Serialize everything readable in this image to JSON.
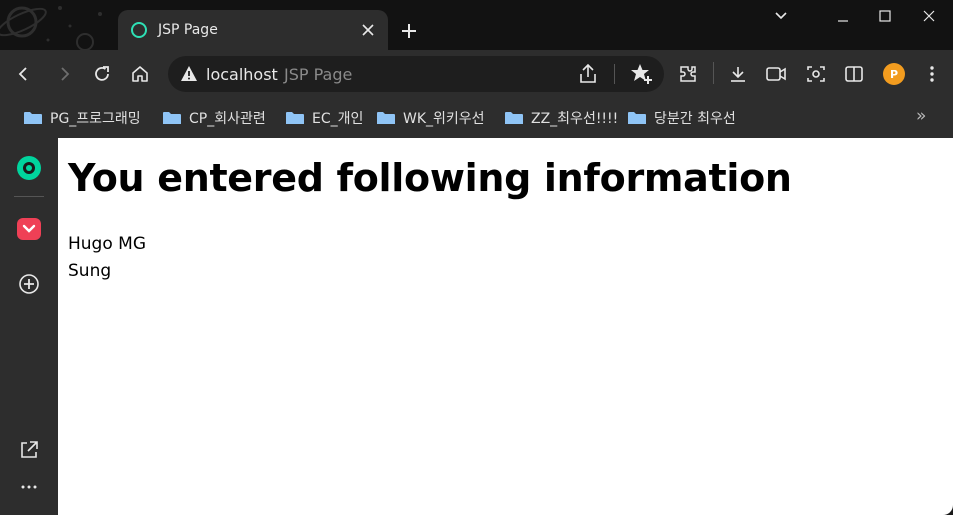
{
  "tab": {
    "title": "JSP Page",
    "close_icon": "close-icon",
    "favicon": "loading-ring-icon"
  },
  "window": {
    "controls": [
      "chevron-down-icon",
      "minimize-icon",
      "maximize-icon",
      "close-icon"
    ]
  },
  "toolbar": {
    "address": {
      "host": "localhost",
      "title": "JSP Page",
      "security_icon": "warning-icon"
    },
    "profile_initial": "P"
  },
  "bookmarks": [
    {
      "label": "PG_프로그래밍"
    },
    {
      "label": "CP_회사관련"
    },
    {
      "label": "EC_개인"
    },
    {
      "label": "WK_위키우선"
    },
    {
      "label": "ZZ_최우선!!!!"
    },
    {
      "label": "당분간 최우선"
    }
  ],
  "bookmarks_more": "»",
  "page": {
    "heading": "You entered following information",
    "lines": [
      "Hugo MG",
      "Sung"
    ]
  },
  "colors": {
    "accent_green": "#00d49d",
    "profile": "#f29c1f",
    "pocket": "#ef4056"
  }
}
